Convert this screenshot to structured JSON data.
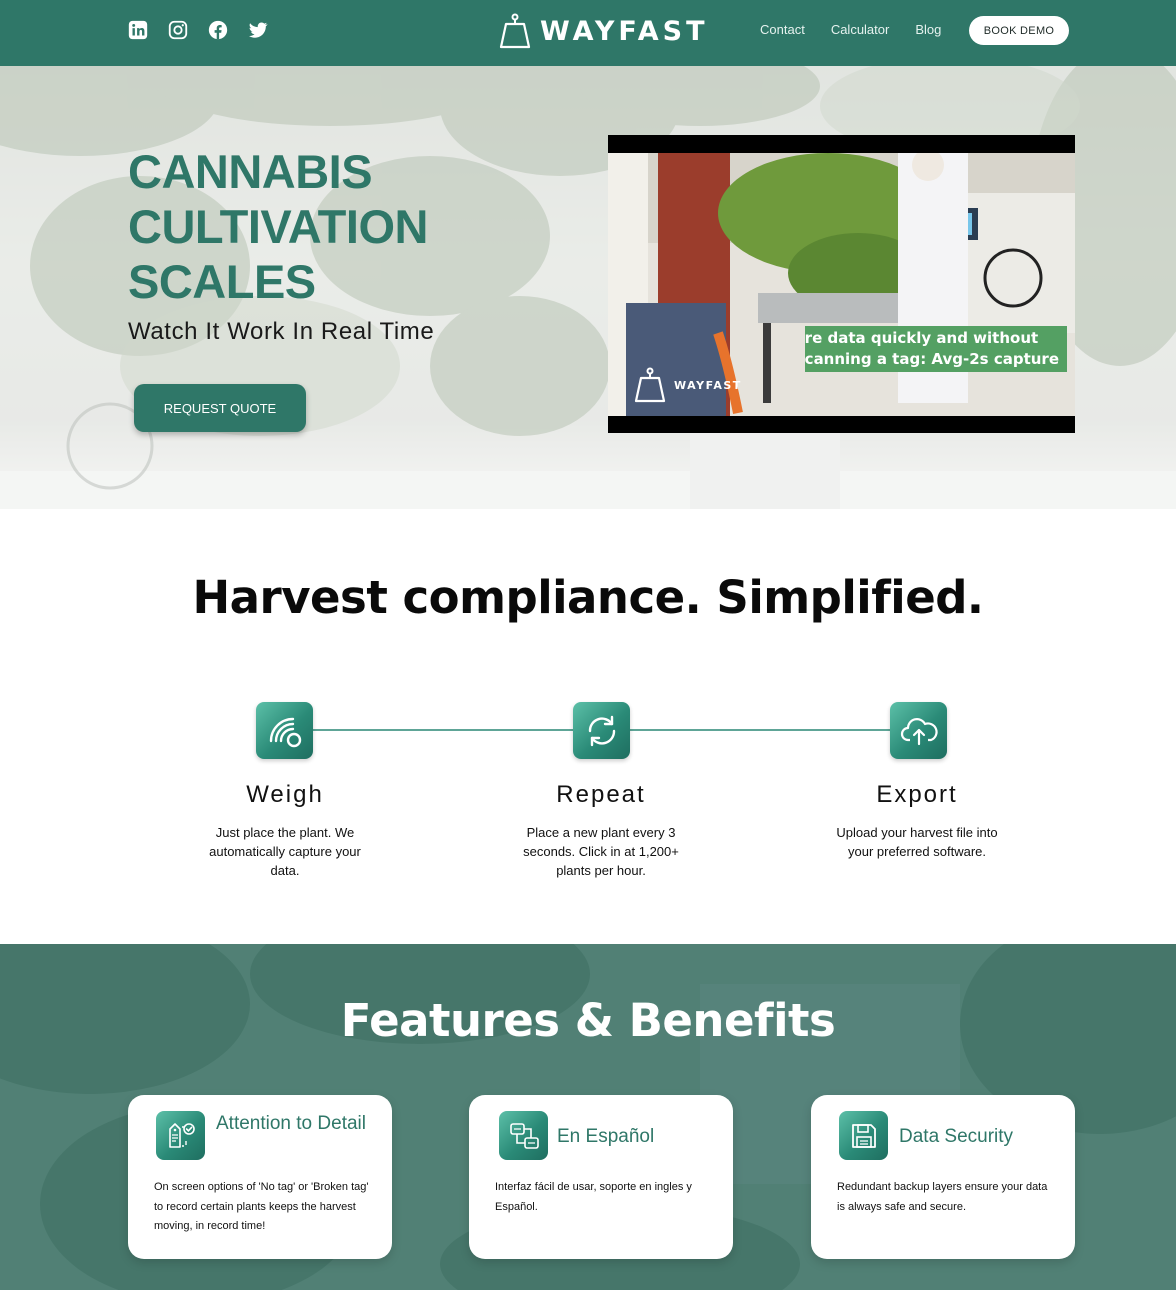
{
  "header": {
    "brand": "WAYFAST",
    "social": [
      "linkedin-icon",
      "instagram-icon",
      "facebook-icon",
      "twitter-icon"
    ],
    "nav": [
      "Contact",
      "Calculator",
      "Blog"
    ],
    "cta": "BOOK DEMO"
  },
  "hero": {
    "title": "CANNABIS CULTIVATION SCALES",
    "subtitle": "Watch It Work In Real Time",
    "button": "REQUEST QUOTE",
    "video": {
      "caption_line1": "re data quickly and without",
      "caption_line2": "canning a tag: Avg-2s capture",
      "watermark": "WAYFAST"
    }
  },
  "compliance": {
    "title": "Harvest compliance. Simplified.",
    "steps": [
      {
        "icon": "scale-signal-icon",
        "title": "Weigh",
        "desc": "Just place the plant. We automatically capture your data."
      },
      {
        "icon": "repeat-icon",
        "title": "Repeat",
        "desc": "Place a new plant every 3 seconds. Click in at 1,200+ plants per hour."
      },
      {
        "icon": "cloud-upload-icon",
        "title": "Export",
        "desc": "Upload your harvest file into your preferred software."
      }
    ]
  },
  "features": {
    "title": "Features & Benefits",
    "cards": [
      {
        "icon": "tag-check-icon",
        "title": "Attention to Detail",
        "desc": "On screen options of 'No tag' or 'Broken tag' to record certain plants keeps the harvest moving, in record time!"
      },
      {
        "icon": "language-flow-icon",
        "title": "En Español",
        "desc": "Interfaz fácil de usar, soporte en ingles y Español."
      },
      {
        "icon": "save-disk-icon",
        "title": "Data Security",
        "desc": "Redundant backup layers ensure your data is always safe and secure."
      }
    ]
  },
  "colors": {
    "brand": "#2f7768",
    "caption": "#54a063"
  }
}
